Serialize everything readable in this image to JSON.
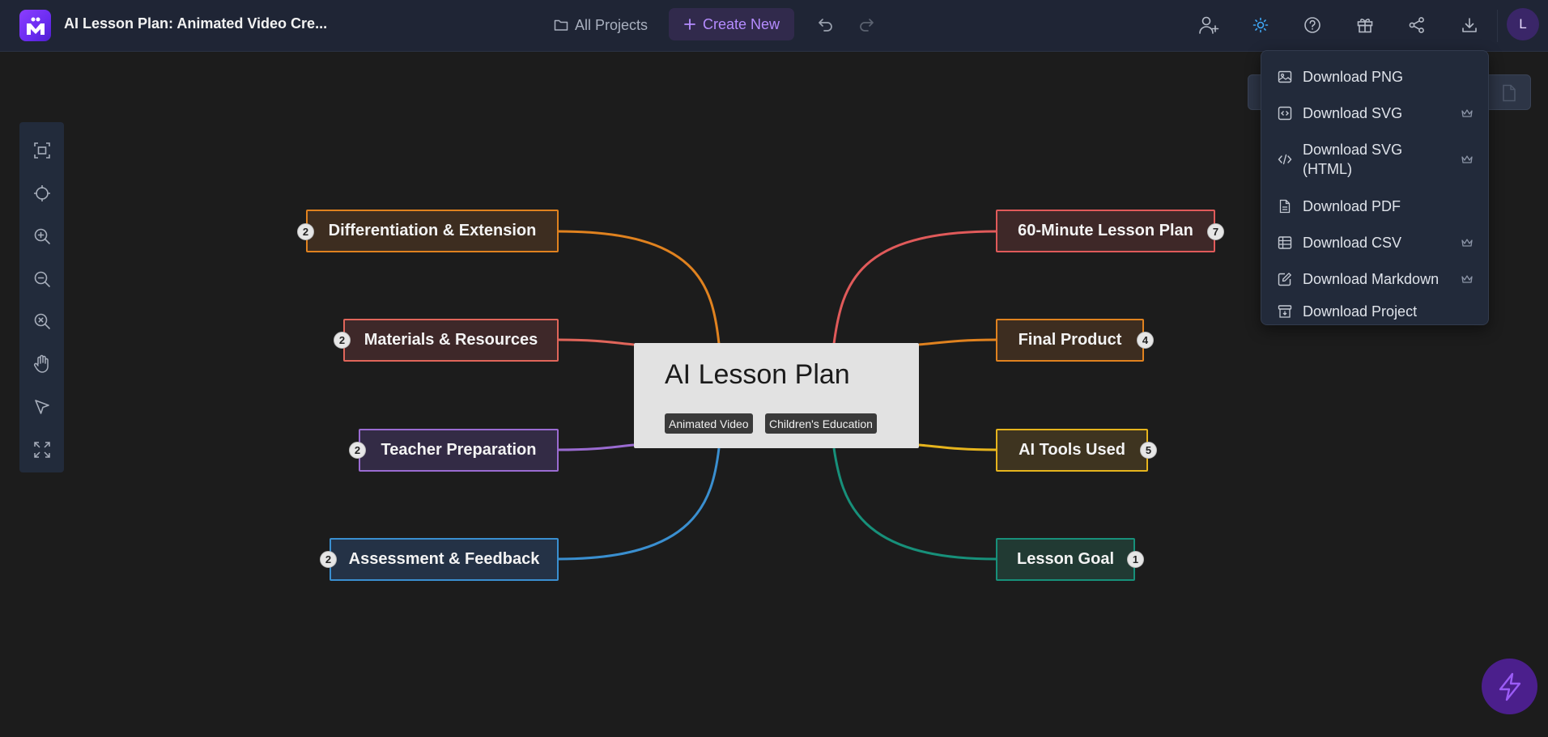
{
  "header": {
    "doc_title": "AI Lesson Plan: Animated Video Cre...",
    "all_projects": "All Projects",
    "create_new": "Create New",
    "avatar_initial": "L"
  },
  "colors": {
    "accent": "#b58cff",
    "background": "#1c1c1c",
    "topbar": "#1f2535"
  },
  "left_toolbar": [
    {
      "name": "fit-view-icon"
    },
    {
      "name": "center-target-icon"
    },
    {
      "name": "zoom-in-icon"
    },
    {
      "name": "zoom-out-icon"
    },
    {
      "name": "zoom-reset-icon"
    },
    {
      "name": "hand-pan-icon"
    },
    {
      "name": "select-pointer-icon"
    },
    {
      "name": "fullscreen-icon"
    }
  ],
  "mindmap": {
    "root": {
      "title": "AI Lesson Plan",
      "tags": [
        "Animated Video",
        "Children's Education"
      ]
    },
    "left_nodes": [
      {
        "label": "Differentiation & Extension",
        "count": "2",
        "color": "#e0821f"
      },
      {
        "label": "Materials & Resources",
        "count": "2",
        "color": "#e0655a"
      },
      {
        "label": "Teacher Preparation",
        "count": "2",
        "color": "#9a6bd1"
      },
      {
        "label": "Assessment & Feedback",
        "count": "2",
        "color": "#3a8fd0"
      }
    ],
    "right_nodes": [
      {
        "label": "60-Minute Lesson Plan",
        "count": "7",
        "color": "#e05a5a"
      },
      {
        "label": "Final Product",
        "count": "4",
        "color": "#e0821f"
      },
      {
        "label": "AI Tools Used",
        "count": "5",
        "color": "#e6b41d"
      },
      {
        "label": "Lesson Goal",
        "count": "1",
        "color": "#17907a"
      }
    ]
  },
  "download_menu": {
    "items": [
      {
        "label": "Download PNG",
        "icon": "image-icon",
        "premium": false
      },
      {
        "label": "Download SVG",
        "icon": "code-square-icon",
        "premium": true
      },
      {
        "label": "Download SVG (HTML)",
        "icon": "code-brackets-icon",
        "premium": true
      },
      {
        "label": "Download PDF",
        "icon": "file-icon",
        "premium": false
      },
      {
        "label": "Download CSV",
        "icon": "table-icon",
        "premium": true
      },
      {
        "label": "Download Markdown",
        "icon": "edit-icon",
        "premium": true
      },
      {
        "label": "Download Project",
        "icon": "archive-icon",
        "premium": false
      }
    ]
  }
}
